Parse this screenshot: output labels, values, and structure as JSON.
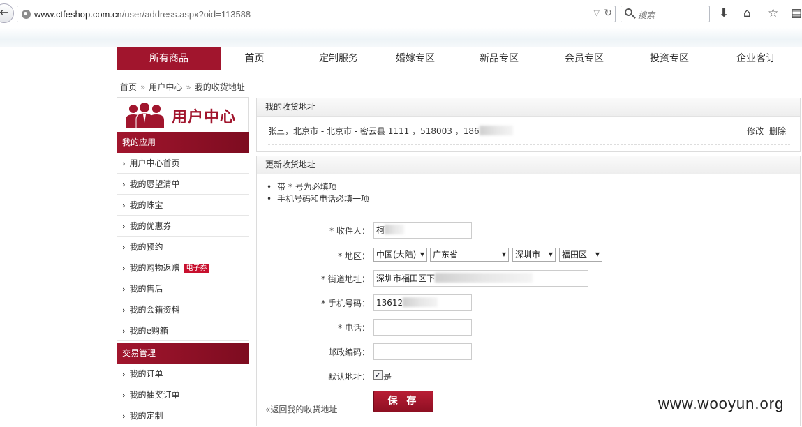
{
  "browser": {
    "back_icon": "←",
    "url_host": "www.ctfeshop.com.cn",
    "url_path": "/user/address.aspx?oid=113588",
    "search_placeholder": "搜索",
    "icons": [
      "download-icon",
      "home-icon",
      "bookmark-star-icon",
      "reader-icon"
    ]
  },
  "nav": {
    "items": [
      "所有商品",
      "首页",
      "定制服务",
      "婚嫁专区",
      "新品专区",
      "会员专区",
      "投资专区",
      "企业客订"
    ]
  },
  "breadcrumb": [
    "首页",
    "用户中心",
    "我的收货地址"
  ],
  "sidebar": {
    "title": "用户中心",
    "section1": "我的应用",
    "apps": [
      "用户中心首页",
      "我的愿望清单",
      "我的珠宝",
      "我的优惠券",
      "我的预约",
      "我的购物返赠",
      "我的售后",
      "我的会籍资料",
      "我的e购箱"
    ],
    "coupon_badge": "电子券",
    "section2": "交易管理",
    "trade": [
      "我的订单",
      "我的抽奖订单",
      "我的定制"
    ]
  },
  "address_panel": {
    "title": "我的收货地址",
    "entry": "张三，北京市 - 北京市 - 密云县 1111 ，518003 ，186",
    "edit": "修改",
    "delete": "删除"
  },
  "form_panel": {
    "title": "更新收货地址",
    "notes": [
      "带 * 号为必填项",
      "手机号码和电话必填一项"
    ],
    "recipient_label": "* 收件人：",
    "recipient_value": "柯",
    "region_label": "* 地区：",
    "country": "中国(大陆)",
    "province": "广东省",
    "city": "深圳市",
    "district": "福田区",
    "street_label": "* 街道地址：",
    "street_value": "深圳市福田区下",
    "mobile_label": "* 手机号码：",
    "mobile_value": "13612",
    "phone_label": "* 电话：",
    "phone_value": "",
    "zip_label": "邮政编码：",
    "zip_value": "",
    "default_label": "默认地址：",
    "default_option": "是",
    "default_checked": true,
    "save": "保 存",
    "back": "«返回我的收货地址"
  },
  "watermark": "www.wooyun.org"
}
